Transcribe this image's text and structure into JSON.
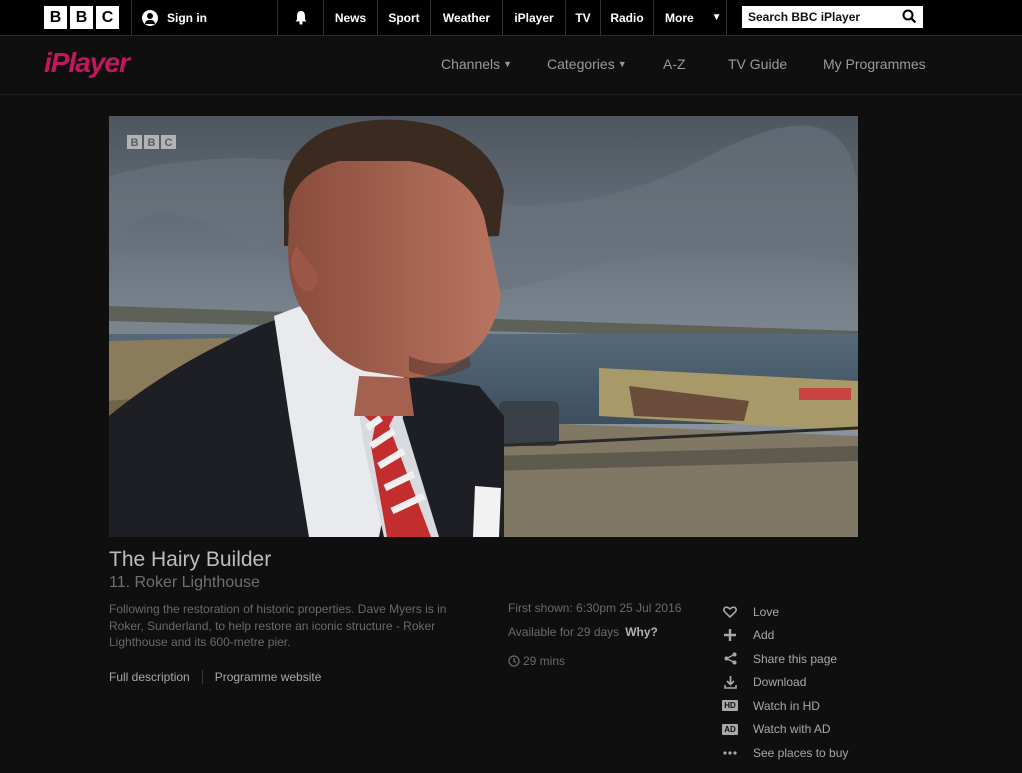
{
  "topbar": {
    "logo": [
      "B",
      "B",
      "C"
    ],
    "sign_in": "Sign in",
    "nav": [
      {
        "label": "News",
        "width": 54
      },
      {
        "label": "Sport",
        "width": 53
      },
      {
        "label": "Weather",
        "width": 72
      },
      {
        "label": "iPlayer",
        "width": 63
      },
      {
        "label": "TV",
        "width": 35
      },
      {
        "label": "Radio",
        "width": 53
      },
      {
        "label": "More",
        "width": 73
      }
    ],
    "search_placeholder": "Search BBC iPlayer"
  },
  "iplayer": {
    "logo": "iPlayer",
    "nav": {
      "channels": "Channels",
      "categories": "Categories",
      "az": "A-Z",
      "tv_guide": "TV Guide",
      "my_programmes": "My Programmes"
    }
  },
  "video": {
    "watermark": "BBC"
  },
  "programme": {
    "title": "The Hairy Builder",
    "episode": "11. Roker Lighthouse",
    "description": "Following the restoration of historic properties. Dave Myers is in Roker, Sunderland, to help restore an iconic structure - Roker Lighthouse and its 600-metre pier.",
    "links": {
      "full_description": "Full description",
      "programme_website": "Programme website"
    },
    "meta": {
      "first_shown": "First shown: 6:30pm 25 Jul 2016",
      "available": "Available for 29 days",
      "why": "Why?",
      "duration": "29 mins"
    }
  },
  "actions": [
    {
      "label": "Love",
      "icon": "heart-icon"
    },
    {
      "label": "Add",
      "icon": "plus-icon"
    },
    {
      "label": "Share this page",
      "icon": "share-icon"
    },
    {
      "label": "Download",
      "icon": "download-icon"
    },
    {
      "label": "Watch in HD",
      "icon": "hd-icon",
      "badge": "HD"
    },
    {
      "label": "Watch with AD",
      "icon": "ad-icon",
      "badge": "AD"
    },
    {
      "label": "See places to buy",
      "icon": "more-dots-icon"
    }
  ],
  "colors": {
    "brand_pink": "#c2185b",
    "background": "#0f0f0f"
  }
}
